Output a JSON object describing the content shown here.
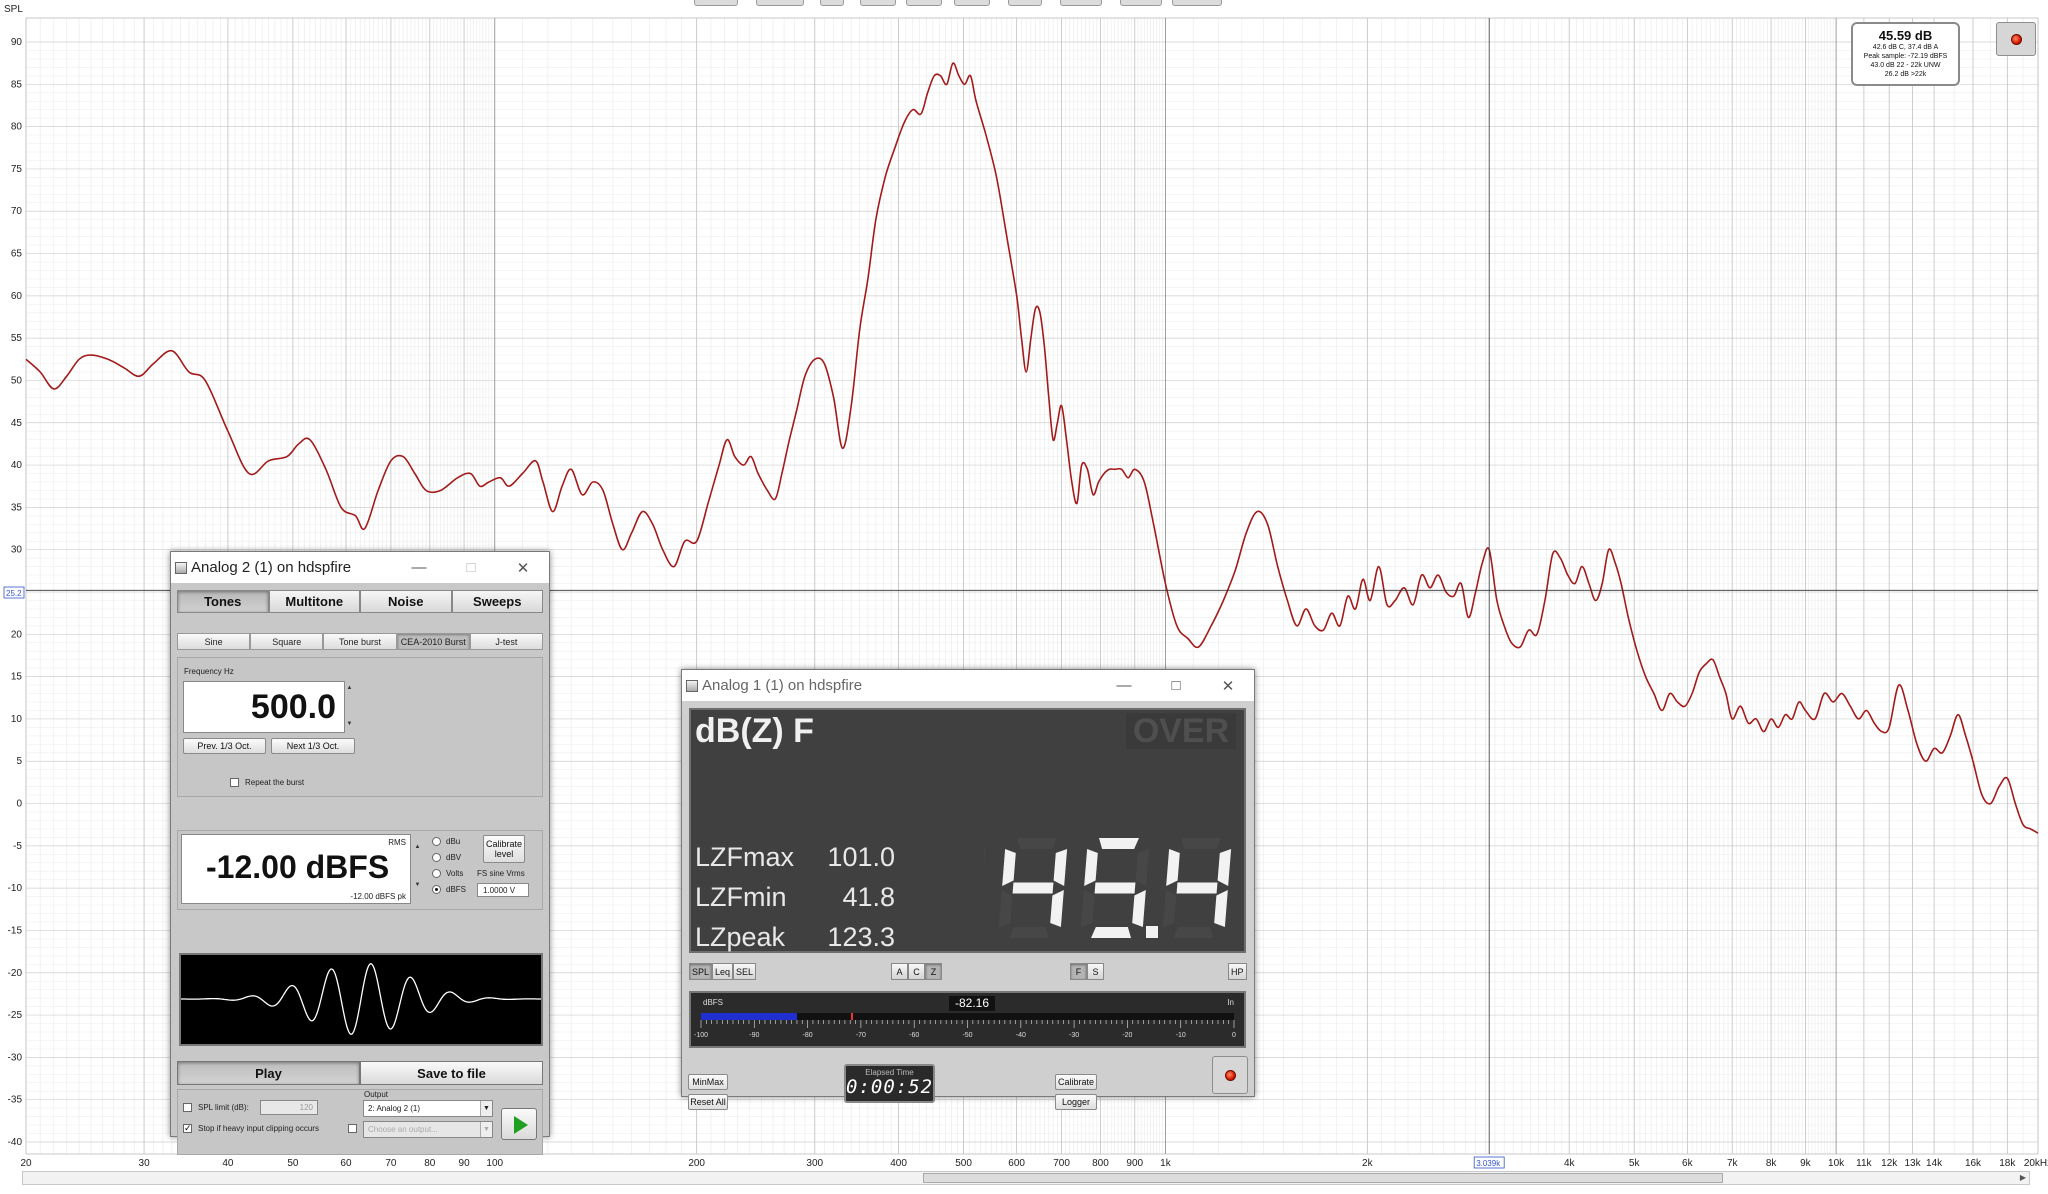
{
  "app": {
    "y_axis_title": "SPL",
    "cursor_y_value": "25.2",
    "cursor_x_value": "3.039k"
  },
  "plot": {
    "x_ticks": [
      {
        "f": 20,
        "label": "20"
      },
      {
        "f": 30,
        "label": "30"
      },
      {
        "f": 40,
        "label": "40"
      },
      {
        "f": 50,
        "label": "50"
      },
      {
        "f": 60,
        "label": "60"
      },
      {
        "f": 70,
        "label": "70"
      },
      {
        "f": 80,
        "label": "80"
      },
      {
        "f": 90,
        "label": "90"
      },
      {
        "f": 100,
        "label": "100"
      },
      {
        "f": 200,
        "label": "200"
      },
      {
        "f": 300,
        "label": "300"
      },
      {
        "f": 400,
        "label": "400"
      },
      {
        "f": 500,
        "label": "500"
      },
      {
        "f": 600,
        "label": "600"
      },
      {
        "f": 700,
        "label": "700"
      },
      {
        "f": 800,
        "label": "800"
      },
      {
        "f": 900,
        "label": "900"
      },
      {
        "f": 1000,
        "label": "1k"
      },
      {
        "f": 2000,
        "label": "2k"
      },
      {
        "f": 4000,
        "label": "4k"
      },
      {
        "f": 5000,
        "label": "5k"
      },
      {
        "f": 6000,
        "label": "6k"
      },
      {
        "f": 7000,
        "label": "7k"
      },
      {
        "f": 8000,
        "label": "8k"
      },
      {
        "f": 9000,
        "label": "9k"
      },
      {
        "f": 10000,
        "label": "10k"
      },
      {
        "f": 11000,
        "label": "11k"
      },
      {
        "f": 12000,
        "label": "12k"
      },
      {
        "f": 13000,
        "label": "13k"
      },
      {
        "f": 14000,
        "label": "14k"
      },
      {
        "f": 16000,
        "label": "16k"
      },
      {
        "f": 18000,
        "label": "18k"
      },
      {
        "f": 20000,
        "label": "20kHz"
      }
    ],
    "y_ticks": [
      90,
      85,
      80,
      75,
      70,
      65,
      60,
      55,
      50,
      45,
      40,
      35,
      30,
      25,
      20,
      15,
      10,
      5,
      0,
      -5,
      -10,
      -15,
      -20,
      -25,
      -30,
      -35,
      -40
    ],
    "line_color": "#a31a1a",
    "curve": [
      [
        20,
        52.5
      ],
      [
        21,
        51
      ],
      [
        22,
        49
      ],
      [
        23,
        50.5
      ],
      [
        24,
        52.5
      ],
      [
        25,
        53
      ],
      [
        26.5,
        52.5
      ],
      [
        28,
        51.5
      ],
      [
        29.5,
        50.5
      ],
      [
        31,
        52
      ],
      [
        33,
        53.5
      ],
      [
        35,
        51
      ],
      [
        37,
        50
      ],
      [
        40,
        44
      ],
      [
        43,
        39
      ],
      [
        46,
        40.5
      ],
      [
        49,
        41
      ],
      [
        51,
        42.5
      ],
      [
        53,
        43
      ],
      [
        56,
        39.5
      ],
      [
        59,
        35
      ],
      [
        62,
        34
      ],
      [
        64,
        32.5
      ],
      [
        67,
        37
      ],
      [
        70,
        40.5
      ],
      [
        73,
        41
      ],
      [
        76,
        39
      ],
      [
        79,
        37
      ],
      [
        83,
        37
      ],
      [
        88,
        38.5
      ],
      [
        92,
        39
      ],
      [
        95,
        37.5
      ],
      [
        98,
        38
      ],
      [
        102,
        38.5
      ],
      [
        105,
        37.5
      ],
      [
        110,
        39
      ],
      [
        115,
        40.5
      ],
      [
        118,
        38
      ],
      [
        122,
        34.5
      ],
      [
        126,
        37.5
      ],
      [
        130,
        39.5
      ],
      [
        135,
        36.5
      ],
      [
        140,
        38
      ],
      [
        145,
        37
      ],
      [
        150,
        33
      ],
      [
        155,
        30
      ],
      [
        160,
        32
      ],
      [
        166,
        34.5
      ],
      [
        172,
        33
      ],
      [
        178,
        30
      ],
      [
        185,
        28
      ],
      [
        192,
        31
      ],
      [
        200,
        31
      ],
      [
        208,
        35.5
      ],
      [
        216,
        40
      ],
      [
        222,
        43
      ],
      [
        228,
        41
      ],
      [
        235,
        40
      ],
      [
        241,
        41
      ],
      [
        247,
        39
      ],
      [
        255,
        37
      ],
      [
        262,
        36
      ],
      [
        268,
        39
      ],
      [
        275,
        43
      ],
      [
        282,
        46.5
      ],
      [
        290,
        50.5
      ],
      [
        300,
        52.5
      ],
      [
        310,
        52
      ],
      [
        320,
        48
      ],
      [
        330,
        42
      ],
      [
        340,
        47
      ],
      [
        350,
        56
      ],
      [
        360,
        62
      ],
      [
        370,
        69
      ],
      [
        382,
        74
      ],
      [
        395,
        77.5
      ],
      [
        408,
        80.5
      ],
      [
        420,
        82
      ],
      [
        432,
        81.5
      ],
      [
        442,
        84
      ],
      [
        452,
        86
      ],
      [
        462,
        86
      ],
      [
        472,
        85
      ],
      [
        482,
        87.5
      ],
      [
        492,
        86
      ],
      [
        502,
        85
      ],
      [
        512,
        86
      ],
      [
        522,
        83
      ],
      [
        540,
        79
      ],
      [
        560,
        74
      ],
      [
        580,
        67
      ],
      [
        600,
        60
      ],
      [
        610,
        55
      ],
      [
        620,
        51
      ],
      [
        630,
        55
      ],
      [
        640,
        58.5
      ],
      [
        650,
        58
      ],
      [
        660,
        54
      ],
      [
        670,
        48
      ],
      [
        680,
        43
      ],
      [
        690,
        45
      ],
      [
        700,
        47
      ],
      [
        712,
        43
      ],
      [
        725,
        38
      ],
      [
        738,
        35.5
      ],
      [
        750,
        40
      ],
      [
        765,
        39.5
      ],
      [
        780,
        36.5
      ],
      [
        795,
        38
      ],
      [
        810,
        39
      ],
      [
        825,
        39.5
      ],
      [
        840,
        39.5
      ],
      [
        860,
        39.5
      ],
      [
        880,
        38.5
      ],
      [
        900,
        39.5
      ],
      [
        930,
        38
      ],
      [
        960,
        33
      ],
      [
        1000,
        26
      ],
      [
        1040,
        21
      ],
      [
        1080,
        19.5
      ],
      [
        1120,
        18.5
      ],
      [
        1170,
        21
      ],
      [
        1220,
        24
      ],
      [
        1270,
        27.5
      ],
      [
        1320,
        32
      ],
      [
        1370,
        34.5
      ],
      [
        1420,
        33
      ],
      [
        1470,
        28
      ],
      [
        1520,
        24
      ],
      [
        1570,
        21
      ],
      [
        1620,
        23
      ],
      [
        1670,
        21
      ],
      [
        1720,
        20.5
      ],
      [
        1770,
        22.5
      ],
      [
        1820,
        21
      ],
      [
        1870,
        24.5
      ],
      [
        1920,
        23
      ],
      [
        1970,
        26.5
      ],
      [
        2020,
        24
      ],
      [
        2080,
        28
      ],
      [
        2140,
        23.5
      ],
      [
        2200,
        24
      ],
      [
        2270,
        25.5
      ],
      [
        2340,
        23.5
      ],
      [
        2410,
        27
      ],
      [
        2480,
        25.5
      ],
      [
        2550,
        27
      ],
      [
        2620,
        25
      ],
      [
        2690,
        24.5
      ],
      [
        2760,
        26
      ],
      [
        2830,
        22
      ],
      [
        2900,
        25
      ],
      [
        2970,
        28.5
      ],
      [
        3039,
        30
      ],
      [
        3120,
        24
      ],
      [
        3200,
        21
      ],
      [
        3280,
        19
      ],
      [
        3380,
        18.5
      ],
      [
        3480,
        20.5
      ],
      [
        3580,
        20
      ],
      [
        3680,
        24
      ],
      [
        3780,
        29.5
      ],
      [
        3880,
        29
      ],
      [
        3980,
        27
      ],
      [
        4080,
        26
      ],
      [
        4180,
        28
      ],
      [
        4280,
        26
      ],
      [
        4380,
        24
      ],
      [
        4480,
        26
      ],
      [
        4580,
        30
      ],
      [
        4680,
        28.5
      ],
      [
        4780,
        26
      ],
      [
        4900,
        22
      ],
      [
        5050,
        18
      ],
      [
        5200,
        15
      ],
      [
        5350,
        13
      ],
      [
        5500,
        11
      ],
      [
        5650,
        13
      ],
      [
        5800,
        12
      ],
      [
        5950,
        11.5
      ],
      [
        6100,
        13
      ],
      [
        6250,
        15.5
      ],
      [
        6400,
        16.5
      ],
      [
        6550,
        17
      ],
      [
        6700,
        15
      ],
      [
        6850,
        13
      ],
      [
        7000,
        10
      ],
      [
        7200,
        11.5
      ],
      [
        7400,
        9.5
      ],
      [
        7600,
        10
      ],
      [
        7800,
        8.5
      ],
      [
        8000,
        10
      ],
      [
        8200,
        9
      ],
      [
        8400,
        10.5
      ],
      [
        8600,
        10
      ],
      [
        8800,
        12
      ],
      [
        9000,
        11
      ],
      [
        9300,
        10
      ],
      [
        9600,
        13
      ],
      [
        9900,
        12
      ],
      [
        10200,
        13
      ],
      [
        10500,
        11.5
      ],
      [
        10800,
        10
      ],
      [
        11100,
        11
      ],
      [
        11400,
        9.5
      ],
      [
        11700,
        8.5
      ],
      [
        12000,
        9
      ],
      [
        12400,
        14
      ],
      [
        12800,
        11
      ],
      [
        13200,
        7
      ],
      [
        13600,
        5
      ],
      [
        14000,
        6.5
      ],
      [
        14400,
        6
      ],
      [
        14800,
        8
      ],
      [
        15200,
        10.5
      ],
      [
        15600,
        8
      ],
      [
        16000,
        5
      ],
      [
        16500,
        1
      ],
      [
        17000,
        0
      ],
      [
        17500,
        2
      ],
      [
        18000,
        3
      ],
      [
        18500,
        0
      ],
      [
        19000,
        -2.5
      ],
      [
        19500,
        -3
      ],
      [
        20000,
        -3.5
      ]
    ]
  },
  "toolbar_stubs": [
    {
      "x": 694,
      "w": 44
    },
    {
      "x": 756,
      "w": 48
    },
    {
      "x": 820,
      "w": 24
    },
    {
      "x": 860,
      "w": 36
    },
    {
      "x": 906,
      "w": 36
    },
    {
      "x": 954,
      "w": 36
    },
    {
      "x": 1008,
      "w": 34
    },
    {
      "x": 1060,
      "w": 42
    },
    {
      "x": 1120,
      "w": 42
    },
    {
      "x": 1172,
      "w": 50
    }
  ],
  "readout": {
    "main": "45.59 dB",
    "line1": "42.6 dB C, 37.4 dB A",
    "line2": "Peak sample: -72.19 dBFS",
    "line3": "43.0 dB 22 - 22k UNW",
    "line4": "26.2 dB >22k"
  },
  "generator": {
    "title": "Analog 2 (1) on hdspfire",
    "tabs": [
      "Tones",
      "Multitone",
      "Noise",
      "Sweeps"
    ],
    "subtabs": [
      "Sine",
      "Square",
      "Tone burst",
      "CEA-2010 Burst",
      "J-test"
    ],
    "frequency_label": "Frequency Hz",
    "frequency_value": "500.0",
    "prev_btn": "Prev. 1/3 Oct.",
    "next_btn": "Next 1/3 Oct.",
    "repeat_label": "Repeat the burst",
    "rms_label": "RMS",
    "level_value": "-12.00 dBFS",
    "level_pk": "-12.00 dBFS pk",
    "units": [
      "dBu",
      "dBV",
      "Volts",
      "dBFS"
    ],
    "calibrate_btn": "Calibrate level",
    "fs_label": "FS sine Vrms",
    "fs_value": "1.0000 V",
    "play_btn": "Play",
    "save_btn": "Save to file",
    "spl_limit_label": "SPL limit (dB):",
    "spl_limit_value": "120",
    "stop_label": "Stop if heavy input clipping occurs",
    "output_label": "Output",
    "output_value": "2: Analog 2 (1)",
    "output2_placeholder": "Choose an output..."
  },
  "spl_meter": {
    "title": "Analog 1 (1) on hdspfire",
    "mode": "dB(Z) F",
    "over": "OVER",
    "stats": [
      {
        "label": "LZFmax",
        "value": "101.0"
      },
      {
        "label": "LZFmin",
        "value": "41.8"
      },
      {
        "label": "LZpeak",
        "value": "123.3"
      }
    ],
    "big_value": "45.4",
    "left_buttons": [
      "SPL",
      "Leq",
      "SEL"
    ],
    "weight_buttons": [
      "A",
      "C",
      "Z"
    ],
    "speed_buttons": [
      "F",
      "S"
    ],
    "hp_button": "HP",
    "dbfs_label": "dBFS",
    "in_label": "In",
    "level_value": "-82.16",
    "level_fraction": 0.18,
    "scale": [
      "-100",
      "-90",
      "-80",
      "-70",
      "-60",
      "-50",
      "-40",
      "-30",
      "-20",
      "-10",
      "0"
    ],
    "minmax_btn": "MinMax",
    "reset_btn": "Reset All",
    "elapsed_label": "Elapsed Time",
    "elapsed_value": "0:00:52",
    "calibrate_btn": "Calibrate",
    "logger_btn": "Logger"
  }
}
